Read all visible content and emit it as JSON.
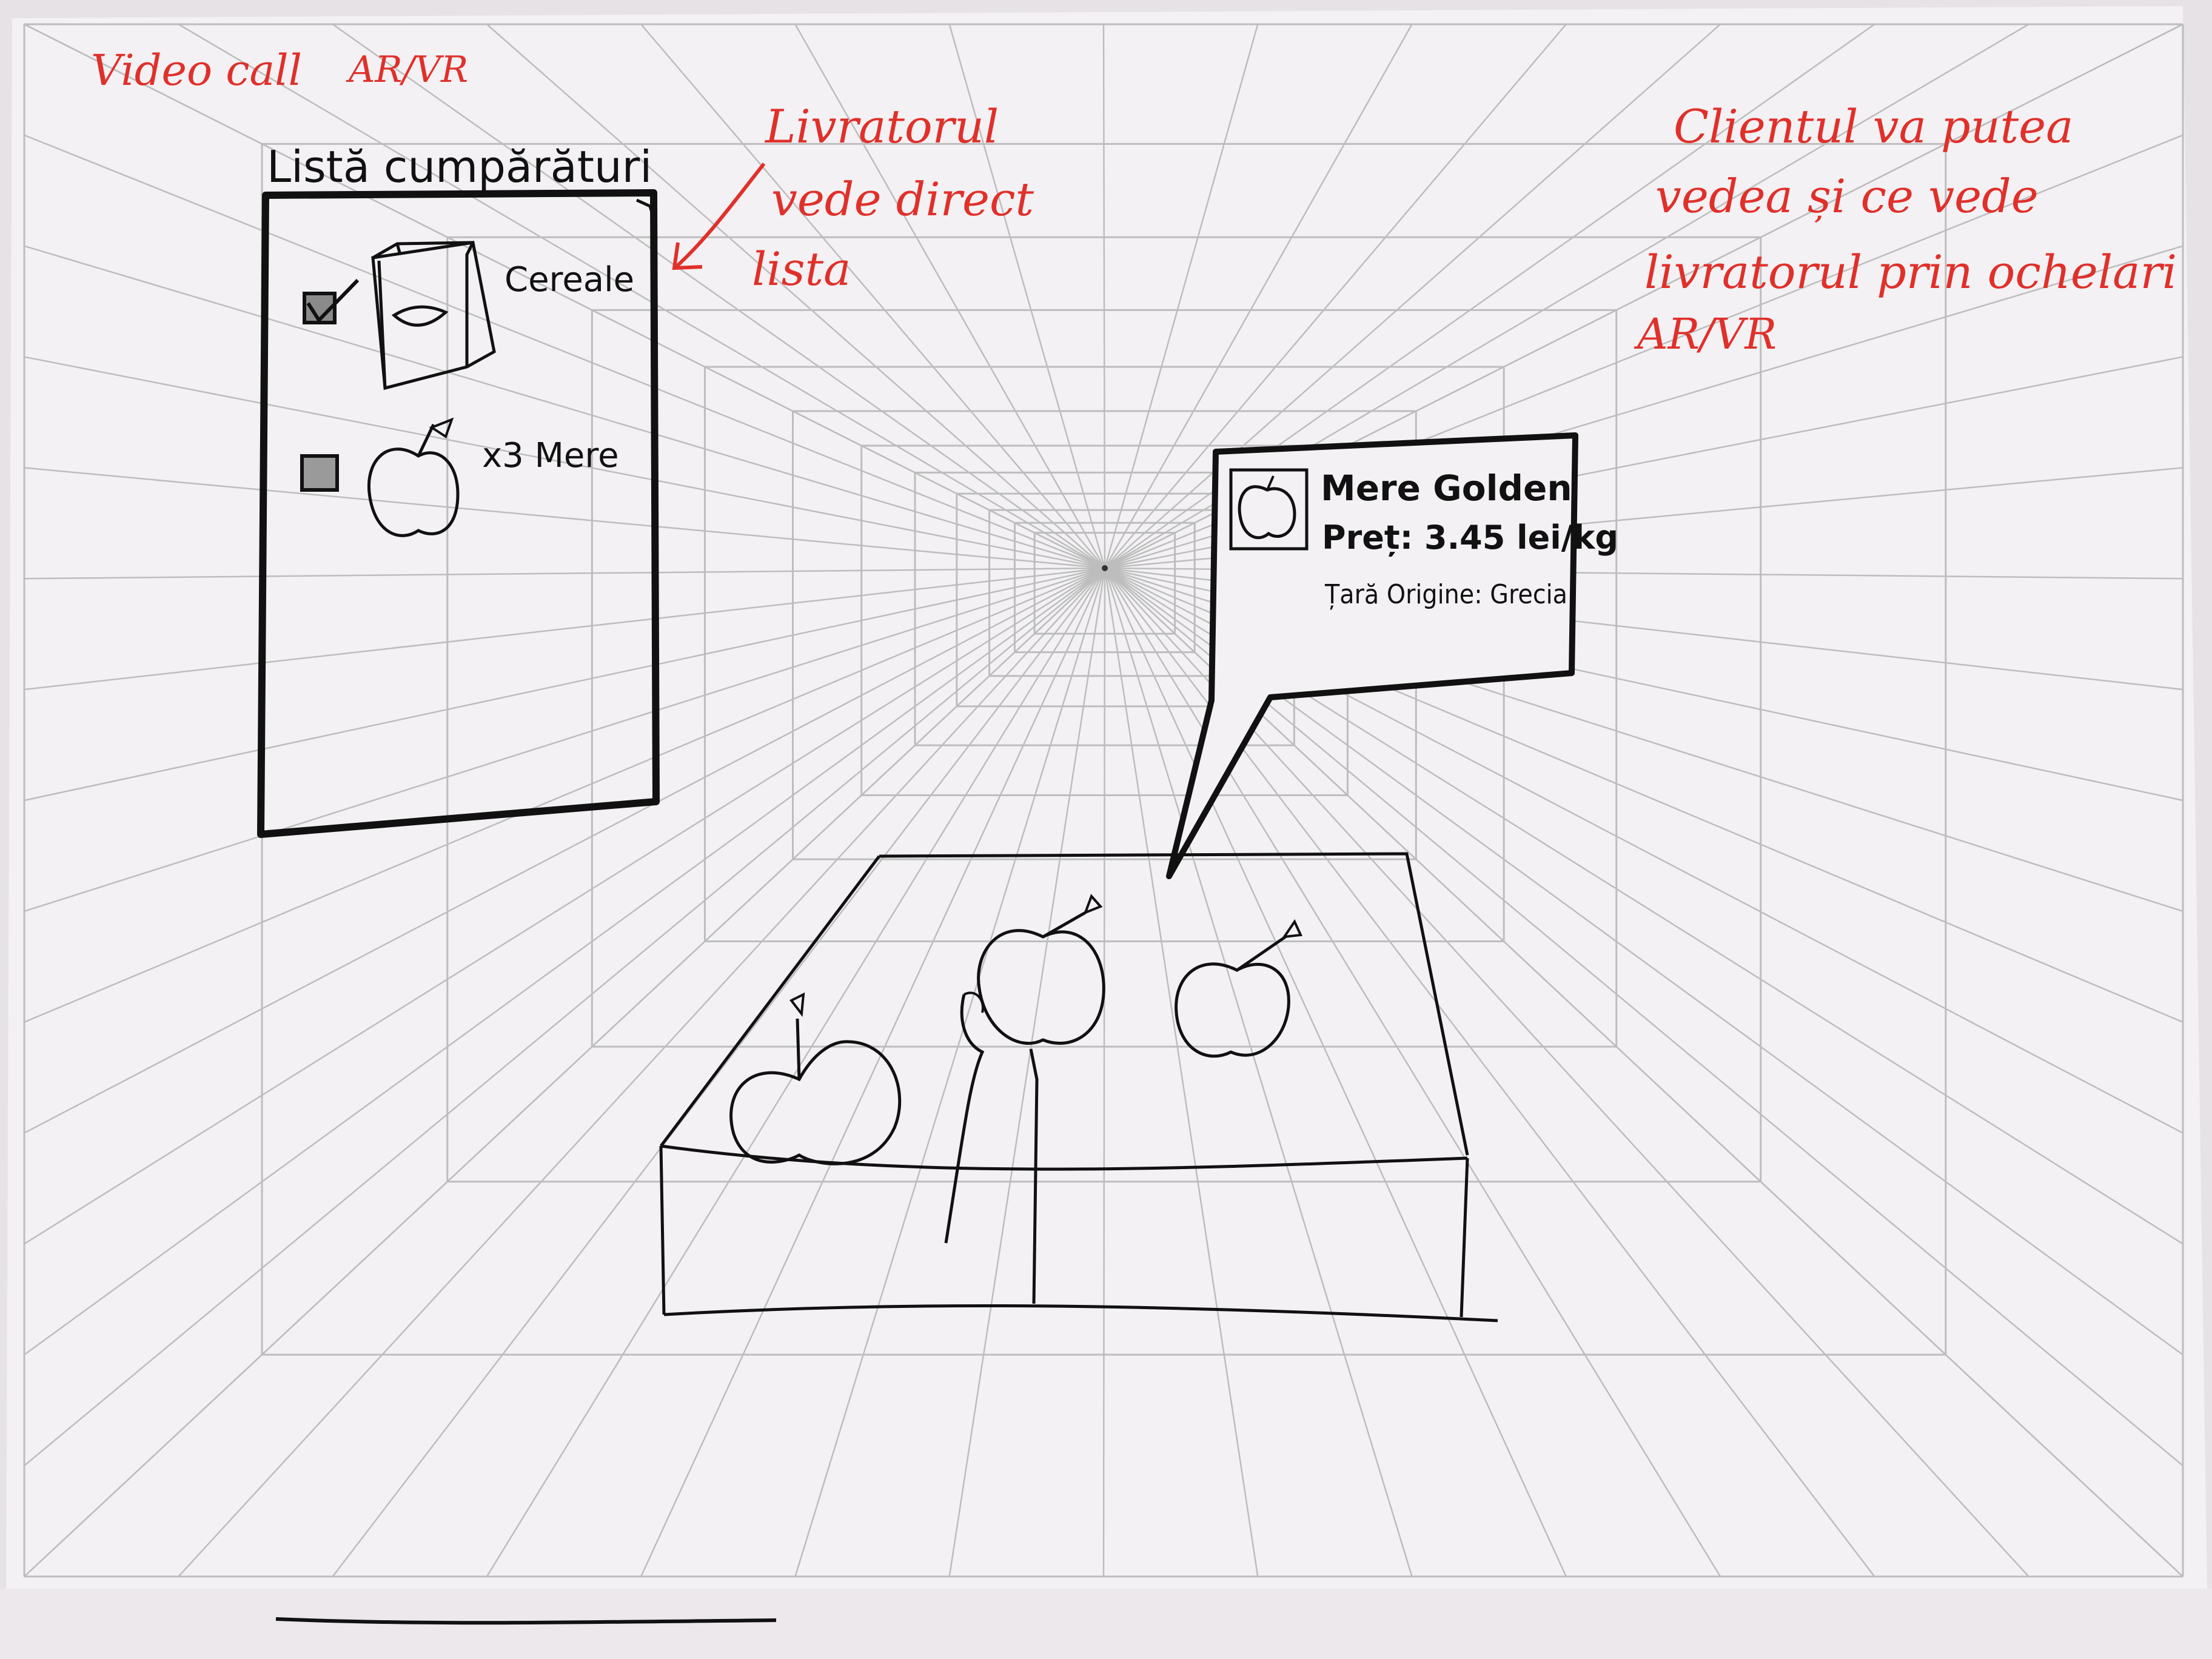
{
  "title": {
    "text": "Video call",
    "tag": "AR/VR"
  },
  "shopping_list": {
    "heading": "Listă cumpărături",
    "items": [
      {
        "label": "Cereale",
        "checked": true,
        "icon": "cereal-box-icon"
      },
      {
        "label": "x3 Mere",
        "checked": false,
        "icon": "apple-icon"
      }
    ]
  },
  "note_left": {
    "lines": [
      "Livratorul",
      "vede direct",
      "lista"
    ]
  },
  "note_right": {
    "lines": [
      "Clientul va putea",
      "vedea și ce vede",
      "livratorul prin ochelari",
      "AR/VR"
    ]
  },
  "product_popup": {
    "name": "Mere Golden",
    "price": "Preț: 3.45 lei/kg",
    "origin": "Țară Origine: Grecia",
    "icon": "apple-icon"
  },
  "colors": {
    "paper": "#f2f0f3",
    "grid": "#bdbdbd",
    "ink": "#111111",
    "annotation": "#e0302a"
  }
}
